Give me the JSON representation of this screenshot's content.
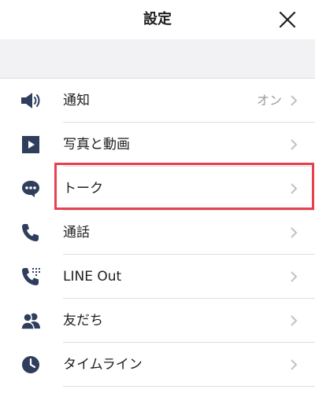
{
  "header": {
    "title": "設定",
    "close_icon": "close-icon"
  },
  "colors": {
    "icon": "#2f3e5c",
    "chevron": "#c2c2c2",
    "value_text": "#9b9b9b",
    "highlight_border": "#e8404c",
    "band": "#f2f2f4"
  },
  "settings": {
    "items": [
      {
        "icon": "speaker-icon",
        "label": "通知",
        "value": "オン"
      },
      {
        "icon": "play-video-icon",
        "label": "写真と動画",
        "value": ""
      },
      {
        "icon": "chat-bubble-icon",
        "label": "トーク",
        "value": ""
      },
      {
        "icon": "phone-icon",
        "label": "通話",
        "value": ""
      },
      {
        "icon": "line-out-phone-icon",
        "label": "LINE Out",
        "value": ""
      },
      {
        "icon": "friends-icon",
        "label": "友だち",
        "value": ""
      },
      {
        "icon": "clock-icon",
        "label": "タイムライン",
        "value": ""
      }
    ],
    "highlighted_index": 2
  }
}
